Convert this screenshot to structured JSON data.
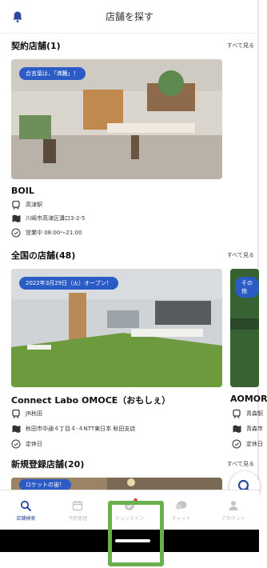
{
  "header": {
    "title": "店舗を探す",
    "icon": "bell-icon"
  },
  "sections": {
    "contract": {
      "title": "契約店舗(1)",
      "see_all": "すべて見る"
    },
    "all": {
      "title": "全国の店舗(48)",
      "see_all": "すべて見る"
    },
    "new": {
      "title": "新規登録店舗(20)",
      "see_all": "すべて見る"
    }
  },
  "cards": {
    "boil": {
      "badge": "合言葉は、「沸騰」！",
      "name": "BOIL",
      "station": "高津駅",
      "address": "川崎市高津区溝口3-2-5",
      "hours": "営業中 08:00〜21:00"
    },
    "omoce": {
      "badge": "2022年3月29日（火）オープン！",
      "name": "Connect Labo OMOCE（おもしぇ）",
      "station": "JR秋田",
      "address": "秋田市中通４丁目４-４NTT東日本 秋田支店",
      "hours": "定休日"
    },
    "aomori": {
      "badge": "その他",
      "name": "AOMORI",
      "station": "青森駅",
      "address": "青森市",
      "hours": "定休日"
    },
    "new1": {
      "badge": "ロケットの宙！"
    }
  },
  "tabbar": {
    "items": [
      {
        "label": "店舗検索",
        "icon": "search-icon",
        "active": true
      },
      {
        "label": "予約管理",
        "icon": "calendar-icon",
        "active": false
      },
      {
        "label": "チェックイン",
        "icon": "checkin-icon",
        "active": false
      },
      {
        "label": "チャット",
        "icon": "chat-icon",
        "active": false
      },
      {
        "label": "アカウント",
        "icon": "account-icon",
        "active": false
      }
    ]
  },
  "colors": {
    "accent": "#2b4a9c",
    "badge_blue": "#2b5bc4",
    "highlight_green": "#6ab04c",
    "notify_red": "#e53935"
  }
}
